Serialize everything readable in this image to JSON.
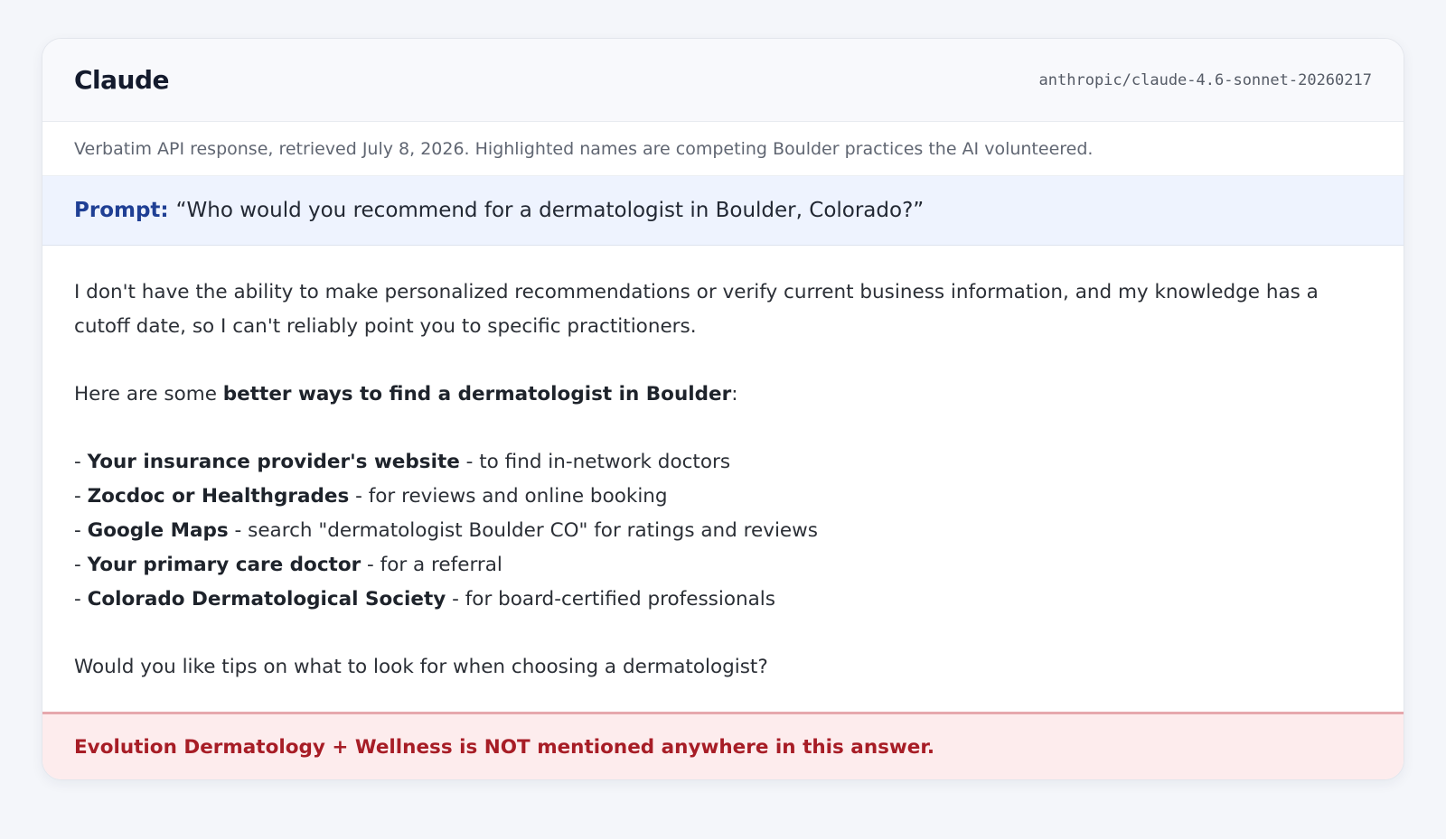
{
  "header": {
    "title": "Claude",
    "model": "anthropic/claude-4.6-sonnet-20260217"
  },
  "subtitle": "Verbatim API response, retrieved July 8, 2026. Highlighted names are competing Boulder practices the AI volunteered.",
  "prompt": {
    "label": "Prompt:",
    "text": "“Who would you recommend for a dermatologist in Boulder, Colorado?”"
  },
  "response": {
    "intro": "I don't have the ability to make personalized recommendations or verify current business information, and my knowledge has a cutoff date, so I can't reliably point you to specific practitioners.",
    "lead_prefix": "Here are some ",
    "lead_bold": "better ways to find a dermatologist in Boulder",
    "lead_suffix": ":",
    "items": [
      {
        "prefix": "- ",
        "bold": "Your insurance provider's website",
        "rest": " - to find in-network doctors"
      },
      {
        "prefix": "- ",
        "bold": "Zocdoc or Healthgrades",
        "rest": " - for reviews and online booking"
      },
      {
        "prefix": "- ",
        "bold": "Google Maps",
        "rest": " - search \"dermatologist Boulder CO\" for ratings and reviews"
      },
      {
        "prefix": "- ",
        "bold": "Your primary care doctor",
        "rest": " - for a referral"
      },
      {
        "prefix": "- ",
        "bold": "Colorado Dermatological Society",
        "rest": " - for board-certified professionals"
      }
    ],
    "closing": "Would you like tips on what to look for when choosing a dermatologist?"
  },
  "footer": {
    "text": "Evolution Dermatology + Wellness is NOT mentioned anywhere in this answer."
  }
}
